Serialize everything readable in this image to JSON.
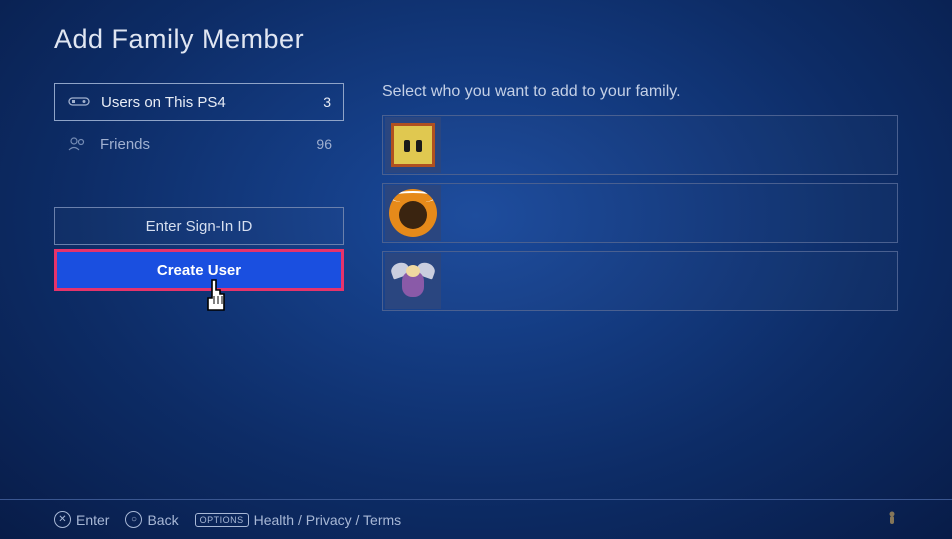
{
  "title": "Add Family Member",
  "sidebar": {
    "categories": [
      {
        "icon": "controller",
        "label": "Users on This PS4",
        "count": 3,
        "selected": true
      },
      {
        "icon": "friends",
        "label": "Friends",
        "count": 96,
        "selected": false
      }
    ],
    "actions": {
      "signin_label": "Enter Sign-In ID",
      "create_label": "Create User"
    }
  },
  "main": {
    "instruction": "Select who you want to add to your family.",
    "users": [
      {
        "avatar": "avatar-block-face"
      },
      {
        "avatar": "avatar-monkey-halo"
      },
      {
        "avatar": "avatar-bee"
      }
    ]
  },
  "footer": {
    "enter": "Enter",
    "back": "Back",
    "options_badge": "OPTIONS",
    "options_text": "Health / Privacy / Terms"
  }
}
